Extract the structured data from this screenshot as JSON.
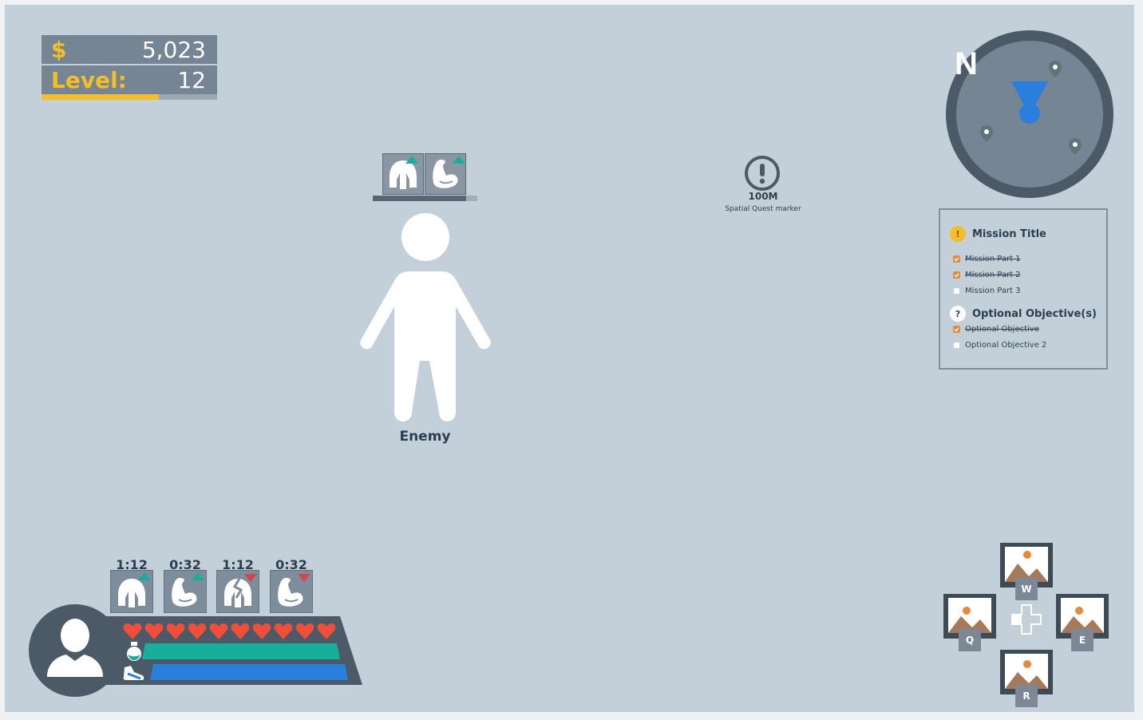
{
  "hud": {
    "currency": {
      "symbol": "$",
      "amount": "5,023"
    },
    "level": {
      "label": "Level:",
      "value": "12",
      "xp_progress": 0.67
    }
  },
  "enemy": {
    "name": "Enemy",
    "health": 0.89,
    "buffs": [
      {
        "icon": "helmet-icon",
        "trend": "up"
      },
      {
        "icon": "muscle-icon",
        "trend": "up"
      }
    ]
  },
  "quest_marker": {
    "distance": "100M",
    "label": "Spatial Quest marker"
  },
  "compass": {
    "north_label": "N",
    "markers": 3
  },
  "missions": {
    "title": "Mission Title",
    "title_badge": "!",
    "parts": [
      {
        "label": "Mission Part 1",
        "done": true
      },
      {
        "label": "Mission Part 2",
        "done": true
      },
      {
        "label": "Mission Part 3",
        "done": false
      }
    ],
    "optional_title": "Optional Objective(s)",
    "optional_badge": "?",
    "optional": [
      {
        "label": "Optional Objective",
        "done": true
      },
      {
        "label": "Optional Objective 2",
        "done": false
      }
    ]
  },
  "player_buffs": [
    {
      "timer": "1:12",
      "icon": "helmet-icon",
      "trend": "up"
    },
    {
      "timer": "0:32",
      "icon": "muscle-icon",
      "trend": "up"
    },
    {
      "timer": "1:12",
      "icon": "broken-helmet-icon",
      "trend": "down"
    },
    {
      "timer": "0:32",
      "icon": "muscle-icon",
      "trend": "down"
    }
  ],
  "player": {
    "hearts": 10,
    "mana": 1.0,
    "stamina": 1.0
  },
  "abilities": [
    {
      "key": "W"
    },
    {
      "key": "Q"
    },
    {
      "key": "E"
    },
    {
      "key": "R"
    }
  ],
  "colors": {
    "background": "#c3d0d9",
    "accent_gold": "#f4bd2a",
    "heart": "#f04e3a",
    "mana": "#17ae9c",
    "stamina": "#2a7fdc",
    "buff_up": "#17ae9c",
    "buff_down": "#d9434f",
    "check": "#e38a3c"
  }
}
